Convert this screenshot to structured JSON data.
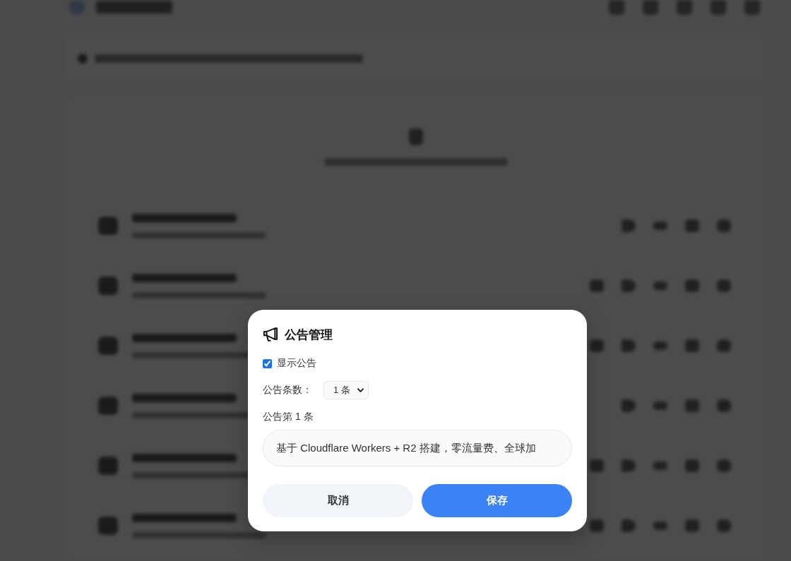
{
  "dialog": {
    "title": "公告管理",
    "show_notice": {
      "label": "显示公告",
      "checked": true
    },
    "count": {
      "label": "公告条数：",
      "value": "1 条"
    },
    "items": [
      {
        "label": "公告第 1 条",
        "value": "基于 Cloudflare Workers + R2 搭建，零流量费、全球加"
      }
    ],
    "buttons": [
      {
        "label": "取消",
        "kind": "secondary"
      },
      {
        "label": "保存",
        "kind": "primary"
      }
    ]
  }
}
